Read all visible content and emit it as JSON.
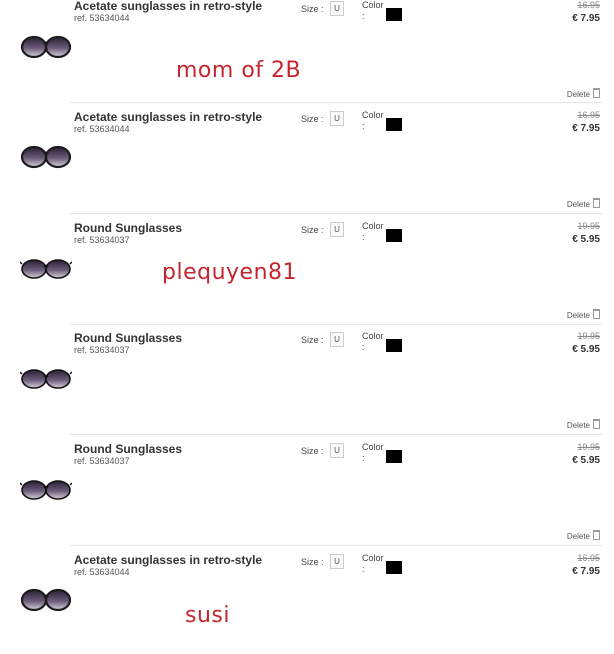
{
  "items": [
    {
      "name": "Acetate sunglasses in retro-style",
      "ref": "ref. 53634044",
      "size_label": "Size :",
      "size": "U",
      "color_label": "Color",
      "color_colon": ":",
      "color_swatch": "#000000",
      "old_price": "16.95",
      "price": "€ 7.95",
      "delete": "Delete",
      "style": "retro"
    },
    {
      "name": "Acetate sunglasses in retro-style",
      "ref": "ref. 53634044",
      "size_label": "Size :",
      "size": "U",
      "color_label": "Color",
      "color_colon": ":",
      "color_swatch": "#000000",
      "old_price": "16.95",
      "price": "€ 7.95",
      "delete": "Delete",
      "style": "retro"
    },
    {
      "name": "Round Sunglasses",
      "ref": "ref. 53634037",
      "size_label": "Size :",
      "size": "U",
      "color_label": "Color",
      "color_colon": ":",
      "color_swatch": "#000000",
      "old_price": "19.95",
      "price": "€ 5.95",
      "delete": "Delete",
      "style": "round"
    },
    {
      "name": "Round Sunglasses",
      "ref": "ref. 53634037",
      "size_label": "Size :",
      "size": "U",
      "color_label": "Color",
      "color_colon": ":",
      "color_swatch": "#000000",
      "old_price": "19.95",
      "price": "€ 5.95",
      "delete": "Delete",
      "style": "round"
    },
    {
      "name": "Round Sunglasses",
      "ref": "ref. 53634037",
      "size_label": "Size :",
      "size": "U",
      "color_label": "Color",
      "color_colon": ":",
      "color_swatch": "#000000",
      "old_price": "19.95",
      "price": "€ 5.95",
      "delete": "Delete",
      "style": "round"
    },
    {
      "name": "Acetate sunglasses in retro-style",
      "ref": "ref. 53634044",
      "size_label": "Size :",
      "size": "U",
      "color_label": "Color",
      "color_colon": ":",
      "color_swatch": "#000000",
      "old_price": "16.95",
      "price": "€ 7.95",
      "delete": null,
      "style": "retro"
    }
  ],
  "annotations": {
    "first": "mom of 2B",
    "second": "plequyen81",
    "third": "susi",
    "color": "#c4262f"
  }
}
